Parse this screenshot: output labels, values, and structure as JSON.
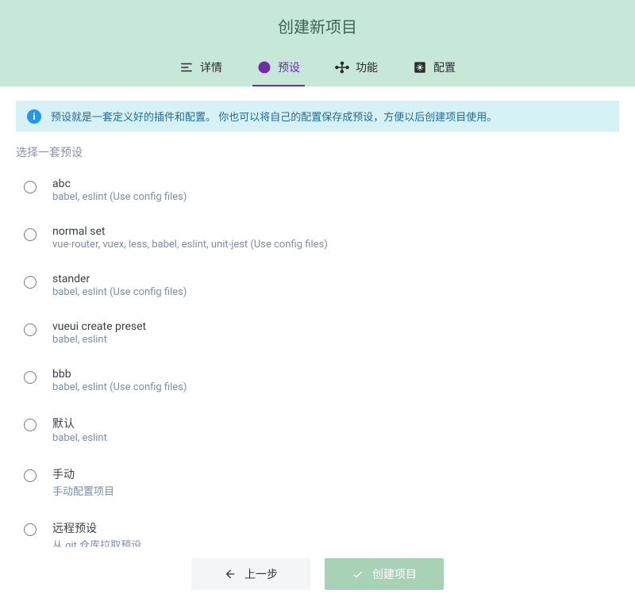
{
  "header": {
    "title": "创建新项目",
    "tabs": [
      {
        "label": "详情",
        "icon": "details-icon"
      },
      {
        "label": "预设",
        "icon": "check-circle-icon",
        "active": true
      },
      {
        "label": "功能",
        "icon": "nodes-icon"
      },
      {
        "label": "配置",
        "icon": "gear-box-icon"
      }
    ]
  },
  "info": {
    "text": "预设就是一套定义好的插件和配置。 你也可以将自己的配置保存成预设，方便以后创建项目使用。"
  },
  "section_title": "选择一套预设",
  "presets": [
    {
      "name": "abc",
      "desc": "babel, eslint (Use config files)"
    },
    {
      "name": "normal set",
      "desc": "vue-router, vuex, less, babel, eslint, unit-jest (Use config files)"
    },
    {
      "name": "stander",
      "desc": "babel, eslint (Use config files)"
    },
    {
      "name": "vueui create preset",
      "desc": "babel, eslint"
    },
    {
      "name": "bbb",
      "desc": "babel, eslint (Use config files)"
    },
    {
      "name": "默认",
      "desc": "babel, eslint"
    },
    {
      "name": "手动",
      "desc": "手动配置项目"
    },
    {
      "name": "远程预设",
      "desc": "从 git 仓库拉取预设"
    }
  ],
  "footer": {
    "back_label": "上一步",
    "create_label": "创建项目"
  }
}
